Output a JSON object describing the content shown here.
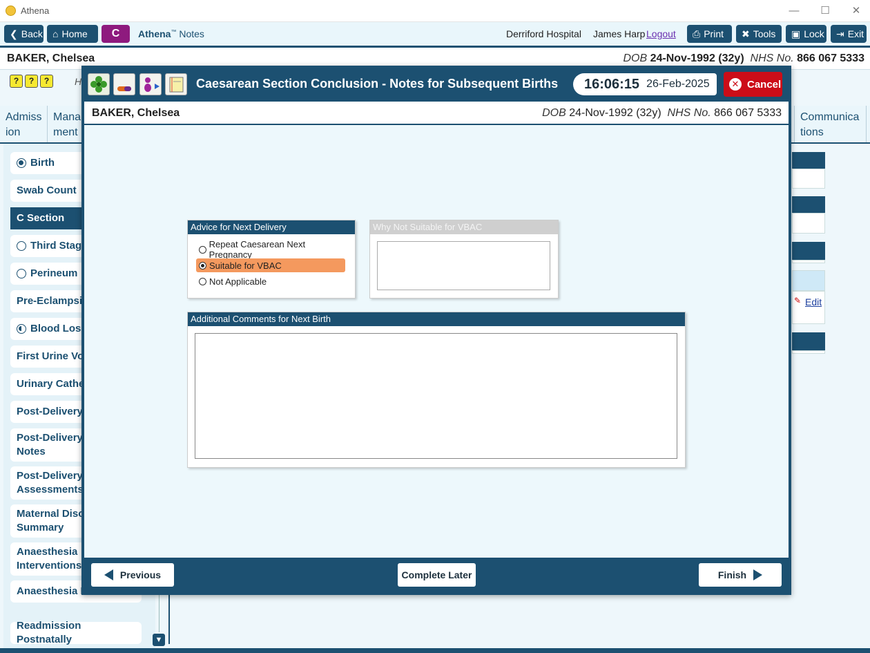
{
  "window": {
    "title": "Athena",
    "minimize": "—",
    "maximize": "☐",
    "close": "✕"
  },
  "toolbar": {
    "back": "Back",
    "home": "Home",
    "notes_badge": "C",
    "app_name": "Athena",
    "app_tm": "™",
    "app_section": "Notes",
    "hospital": "Derriford Hospital",
    "user": "James Harp",
    "logout": "Logout",
    "print": "Print",
    "tools": "Tools",
    "lock": "Lock",
    "exit": "Exit"
  },
  "patient": {
    "name": "BAKER, Chelsea",
    "dob_label": "DOB",
    "dob": "24-Nov-1992 (32y)",
    "nhs_label": "NHS No.",
    "nhs": "866 067 5333"
  },
  "help_icons": [
    "?",
    "?",
    "?"
  ],
  "background_hint": "H",
  "tabs": {
    "admission": "Admiss ion",
    "management": "Mana ment",
    "communications": "Communica tions"
  },
  "sidebar": {
    "birth": "Birth",
    "swab": "Swab Count",
    "csection": "C Section",
    "third": "Third Stage",
    "perineum": "Perineum",
    "preeclampsia": "Pre-Eclampsia",
    "bloodloss": "Blood Loss",
    "urine": "First Urine Voi",
    "catheter": "Urinary Cathe",
    "postdelivery": "Post-Delivery",
    "pdnotes1": "Post-Delivery",
    "pdnotes2": "Notes",
    "pdassess1": "Post-Delivery",
    "pdassess2": "Assessments",
    "maternal1": "Maternal Disc",
    "maternal2": "Summary",
    "anaes1": "Anaesthesia",
    "anaes2": "Interventions",
    "anaesfu": "Anaesthesia Fo",
    "readmission": "Readmission Postnatally"
  },
  "right_panel": {
    "edit": "Edit"
  },
  "modal": {
    "title": "Caesarean Section Conclusion - Notes for Subsequent Births",
    "time": "16:06:15",
    "date": "26-Feb-2025",
    "cancel": "Cancel",
    "advice": {
      "header": "Advice for Next Delivery",
      "options": [
        "Repeat Caesarean Next Pregnancy",
        "Suitable for VBAC",
        "Not Applicable"
      ],
      "selected": "Suitable for VBAC"
    },
    "why_not": {
      "header": "Why Not Suitable for VBAC",
      "value": ""
    },
    "comments": {
      "header": "Additional Comments for Next Birth",
      "value": ""
    },
    "previous": "Previous",
    "complete_later": "Complete Later",
    "finish": "Finish"
  },
  "colors": {
    "primary": "#1c5071",
    "selected": "#f4995e",
    "cancel": "#cc0d18",
    "badge": "#8e1a7e"
  }
}
